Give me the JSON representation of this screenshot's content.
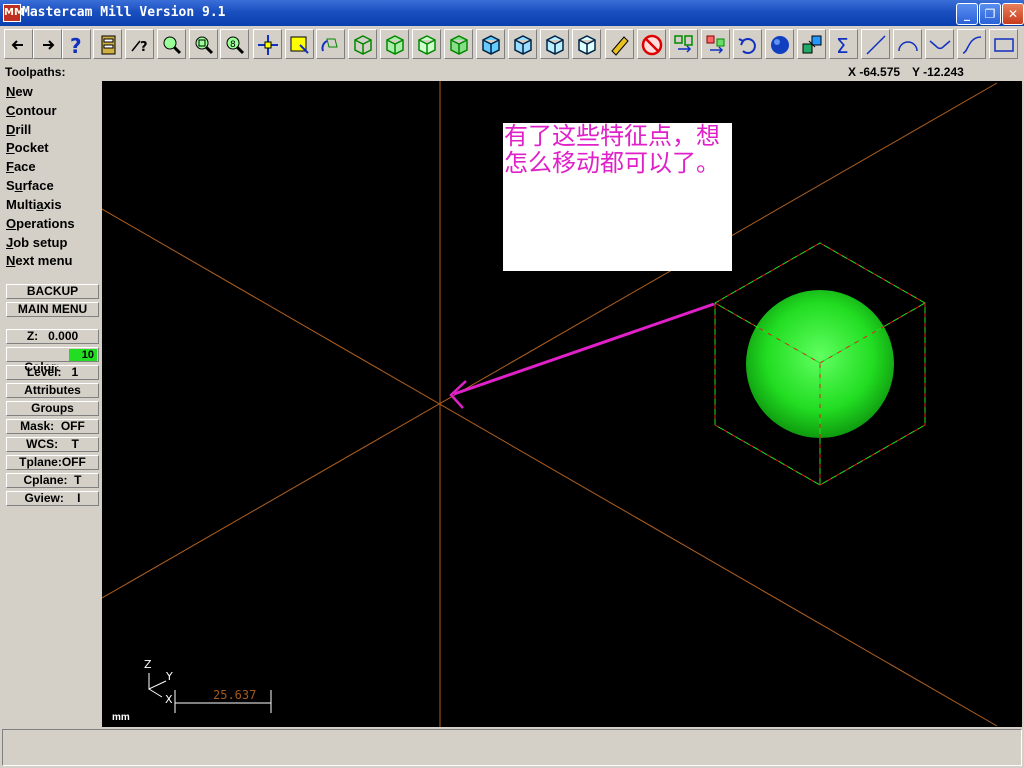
{
  "window": {
    "title": "Mastercam Mill Version 9.1",
    "app_icon_text": "MM",
    "controls": [
      "minimize",
      "maximize",
      "close"
    ]
  },
  "toolbar": {
    "icons": [
      "back-arrow",
      "forward-arrow",
      "help",
      "config",
      "pointer-help",
      "zoom-window",
      "zoom-in",
      "zoom-out",
      "pan",
      "select-box",
      "rotate",
      "view-iso",
      "view-front",
      "view-side",
      "view-top",
      "view-shade",
      "view-wire",
      "view-hidden",
      "view-box",
      "eraser",
      "no-entry",
      "transform-1",
      "transform-2",
      "undo",
      "sphere",
      "layers",
      "sum",
      "line",
      "arc",
      "fillet",
      "spline",
      "rectangle"
    ]
  },
  "status": {
    "toolpaths_label": "Toolpaths:",
    "coord_x": "X -64.575",
    "coord_y": "Y -12.243"
  },
  "menu": {
    "items": [
      {
        "u": "N",
        "rest": "ew"
      },
      {
        "u": "C",
        "rest": "ontour"
      },
      {
        "u": "D",
        "rest": "rill"
      },
      {
        "u": "P",
        "rest": "ocket"
      },
      {
        "u": "F",
        "rest": "ace"
      },
      {
        "pre": "S",
        "u": "u",
        "rest": "rface"
      },
      {
        "pre": "Multi",
        "u": "a",
        "rest": "xis"
      },
      {
        "u": "O",
        "rest": "perations"
      },
      {
        "u": "J",
        "rest": "ob setup"
      },
      {
        "u": "N",
        "rest": "ext menu"
      }
    ],
    "backup": "BACKUP",
    "main_menu": "MAIN MENU"
  },
  "secondary": {
    "z": "Z:   0.000",
    "color_label": "Color:",
    "color_value": "10",
    "level": "Level:   1",
    "attributes": "Attributes",
    "groups": "Groups",
    "mask": "Mask:  OFF",
    "wcs": "WCS:    T",
    "tplane": "Tplane:OFF",
    "cplane": "Cplane:  T",
    "gview": "Gview:    I"
  },
  "viewport": {
    "note_text": "有了这些特征点，想怎么移动都可以了。",
    "scale_value": "25.637",
    "unit": "mm",
    "axis_z": "Z",
    "axis_y": "Y",
    "axis_x": "X",
    "colors": {
      "axes": "#b06020",
      "sphere": "#22dd22",
      "box_red": "#e02020",
      "box_green": "#20e020",
      "arrow": "#e020c8"
    }
  }
}
